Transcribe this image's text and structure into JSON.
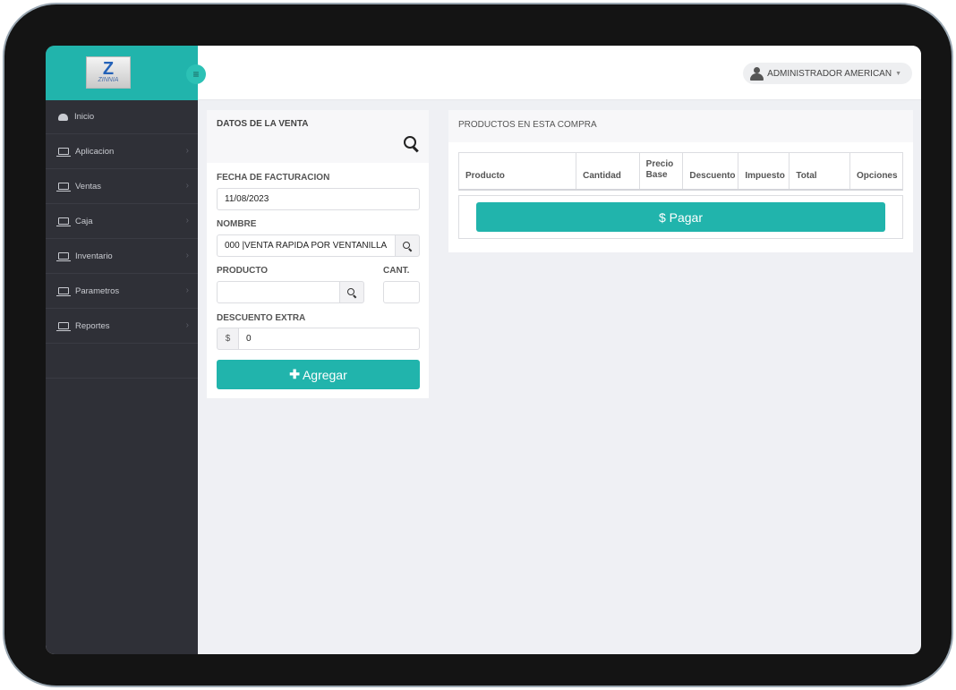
{
  "sidebar": {
    "logo": {
      "letter": "Z",
      "text": "ZINNIA"
    },
    "toggle_icon": "menu-icon",
    "items": [
      {
        "label": "Inicio",
        "icon": "dashboard-icon"
      },
      {
        "label": "Aplicacion",
        "icon": "laptop-icon"
      },
      {
        "label": "Ventas",
        "icon": "laptop-icon"
      },
      {
        "label": "Caja",
        "icon": "laptop-icon"
      },
      {
        "label": "Inventario",
        "icon": "laptop-icon"
      },
      {
        "label": "Parametros",
        "icon": "laptop-icon"
      },
      {
        "label": "Reportes",
        "icon": "laptop-icon"
      }
    ]
  },
  "header": {
    "user_name": "ADMINISTRADOR AMERICAN"
  },
  "sale_form": {
    "title": "DATOS DE LA VENTA",
    "date_label": "FECHA DE FACTURACION",
    "date_value": "11/08/2023",
    "name_label": "NOMBRE",
    "name_value": "000 |VENTA RAPIDA POR VENTANILLA",
    "product_label": "PRODUCTO",
    "product_value": "",
    "qty_label": "CANT.",
    "qty_value": "",
    "discount_label": "DESCUENTO EXTRA",
    "discount_prefix": "$",
    "discount_value": "0",
    "add_button": "Agregar"
  },
  "purchase": {
    "title": "PRODUCTOS EN ESTA COMPRA",
    "columns": [
      "Producto",
      "Cantidad",
      "Precio Base",
      "Descuento",
      "Impuesto",
      "Total",
      "Opciones"
    ],
    "pay_button": "$ Pagar"
  },
  "colors": {
    "accent": "#21b4ac",
    "sidebar_bg": "#2f3037",
    "content_bg": "#eff0f4"
  }
}
